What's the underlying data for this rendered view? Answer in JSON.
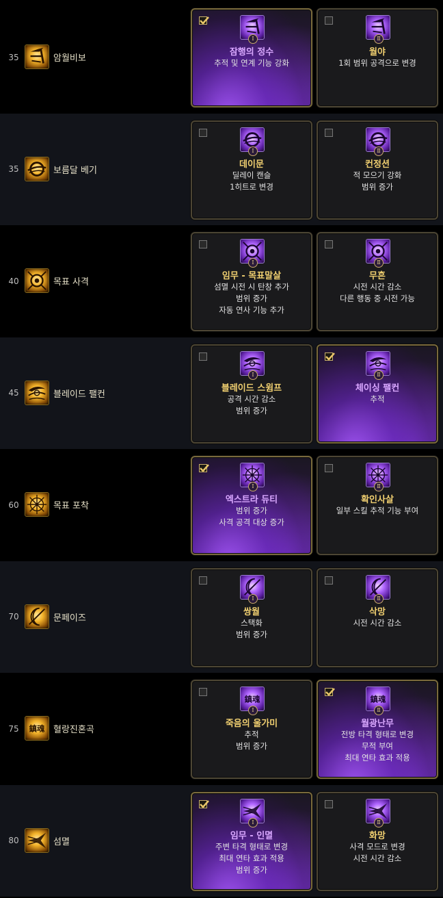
{
  "rows": [
    {
      "level": "35",
      "skill": "암월비보",
      "skill_icon": "hidden-blade-skill-icon",
      "tiers": [
        {
          "numeral": "Ⅰ",
          "title": "잠행의 정수",
          "desc": [
            "추적 및 연계 기능 강화"
          ],
          "selected": true,
          "icon": "hidden-blade-tier-icon"
        },
        {
          "numeral": "Ⅱ",
          "title": "월야",
          "desc": [
            "1회 범위 공격으로 변경"
          ],
          "selected": false,
          "icon": "hidden-blade-tier-icon"
        }
      ]
    },
    {
      "level": "35",
      "skill": "보름달 베기",
      "skill_icon": "full-moon-slash-skill-icon",
      "tiers": [
        {
          "numeral": "Ⅰ",
          "title": "데이문",
          "desc": [
            "딜레이 캔슬",
            "1히트로 변경"
          ],
          "selected": false,
          "icon": "full-moon-slash-tier-icon"
        },
        {
          "numeral": "Ⅱ",
          "title": "컨정션",
          "desc": [
            "적 모으기 강화",
            "범위 증가"
          ],
          "selected": false,
          "icon": "full-moon-slash-tier-icon"
        }
      ]
    },
    {
      "level": "40",
      "skill": "목표 사격",
      "skill_icon": "target-shot-skill-icon",
      "tiers": [
        {
          "numeral": "Ⅰ",
          "title": "임무 - 목표말살",
          "desc": [
            "섬멸 시전 시 탄창 추가",
            "범위 증가",
            "자동 연사 기능 추가"
          ],
          "selected": false,
          "icon": "target-shot-tier-icon"
        },
        {
          "numeral": "Ⅱ",
          "title": "무흔",
          "desc": [
            "시전 시간 감소",
            "다른 행동 중 시전 가능"
          ],
          "selected": false,
          "icon": "target-shot-tier-icon"
        }
      ]
    },
    {
      "level": "45",
      "skill": "블레이드 팰컨",
      "skill_icon": "blade-falcon-skill-icon",
      "tiers": [
        {
          "numeral": "Ⅰ",
          "title": "블레이드 스윔프",
          "desc": [
            "공격 시간 감소",
            "범위 증가"
          ],
          "selected": false,
          "icon": "blade-falcon-tier-icon"
        },
        {
          "numeral": "Ⅱ",
          "title": "체이싱 팰컨",
          "desc": [
            "추적"
          ],
          "selected": true,
          "icon": "blade-falcon-tier-icon"
        }
      ]
    },
    {
      "level": "60",
      "skill": "목표 포착",
      "skill_icon": "target-lock-skill-icon",
      "tiers": [
        {
          "numeral": "Ⅰ",
          "title": "엑스트라 듀티",
          "desc": [
            "범위 증가",
            "사격 공격 대상 증가"
          ],
          "selected": true,
          "icon": "target-lock-tier-icon"
        },
        {
          "numeral": "Ⅱ",
          "title": "확인사살",
          "desc": [
            "일부 스킬 추적 기능 부여"
          ],
          "selected": false,
          "icon": "target-lock-tier-icon"
        }
      ]
    },
    {
      "level": "70",
      "skill": "문페이즈",
      "skill_icon": "moon-phase-skill-icon",
      "tiers": [
        {
          "numeral": "Ⅰ",
          "title": "쌍월",
          "desc": [
            "스택화",
            "범위 증가"
          ],
          "selected": false,
          "icon": "moon-phase-tier-icon"
        },
        {
          "numeral": "Ⅱ",
          "title": "삭망",
          "desc": [
            "시전 시간 감소"
          ],
          "selected": false,
          "icon": "moon-phase-tier-icon"
        }
      ]
    },
    {
      "level": "75",
      "skill": "혈랑진혼곡",
      "skill_icon": "blood-wolf-requiem-skill-icon",
      "skill_icon_text": "鎮魂",
      "tiers": [
        {
          "numeral": "Ⅰ",
          "title": "죽음의 울가미",
          "desc": [
            "추적",
            "범위 증가"
          ],
          "selected": false,
          "icon": "blood-wolf-requiem-tier-icon",
          "icon_text": "鎮魂"
        },
        {
          "numeral": "Ⅱ",
          "title": "월광난무",
          "desc": [
            "전방 타격 형태로 변경",
            "무적 부여",
            "최대 연타 효과 적용"
          ],
          "selected": true,
          "icon": "blood-wolf-requiem-tier-icon",
          "icon_text": "鎮魂"
        }
      ]
    },
    {
      "level": "80",
      "skill": "섬멸",
      "skill_icon": "annihilation-skill-icon",
      "tiers": [
        {
          "numeral": "Ⅰ",
          "title": "임무 - 인멸",
          "desc": [
            "주변 타격 형태로 변경",
            "최대 연타 효과 적용",
            "범위 증가"
          ],
          "selected": true,
          "icon": "annihilation-tier-icon"
        },
        {
          "numeral": "Ⅱ",
          "title": "화망",
          "desc": [
            "사격 모드로 변경",
            "시전 시간 감소"
          ],
          "selected": false,
          "icon": "annihilation-tier-icon"
        }
      ]
    }
  ]
}
